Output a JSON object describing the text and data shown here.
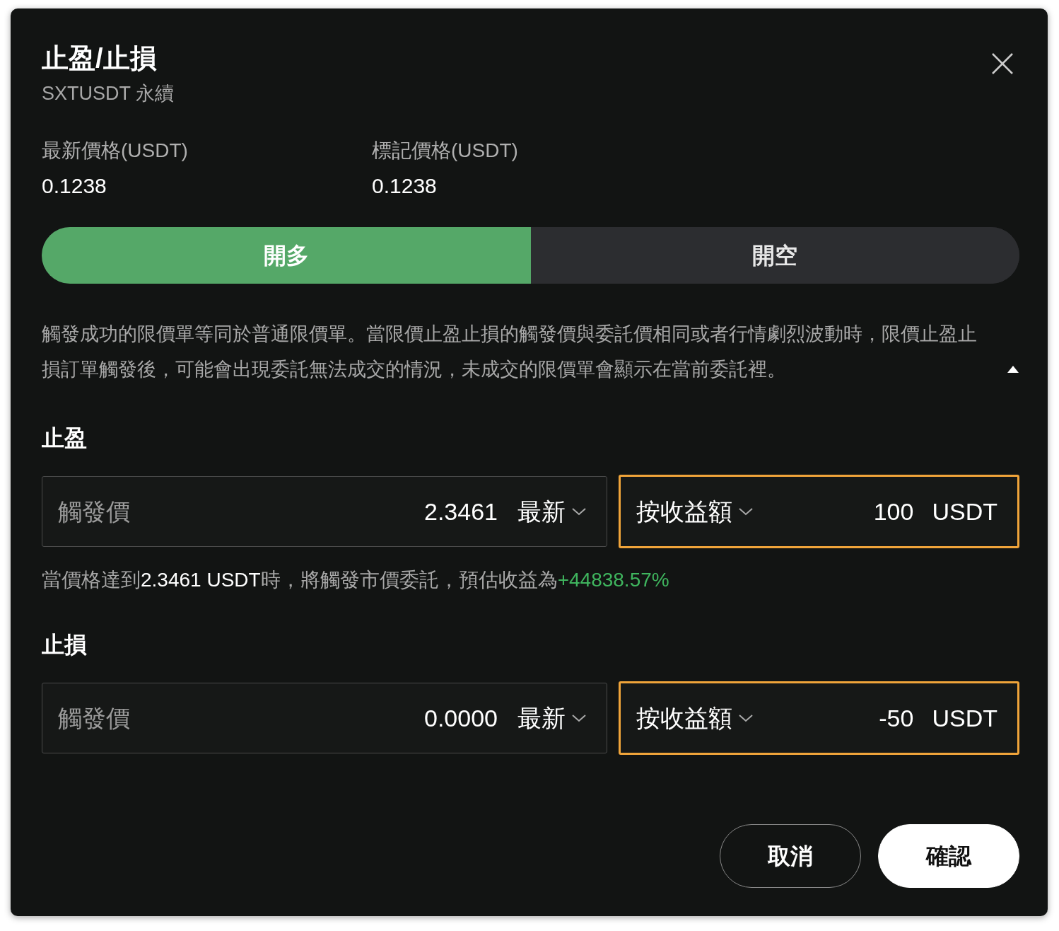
{
  "dialog": {
    "title": "止盈/止損",
    "subtitle": "SXTUSDT 永續"
  },
  "prices": [
    {
      "label": "最新價格(USDT)",
      "value": "0.1238"
    },
    {
      "label": "標記價格(USDT)",
      "value": "0.1238"
    }
  ],
  "tabs": [
    {
      "label": "開多",
      "selected": true
    },
    {
      "label": "開空",
      "selected": false
    }
  ],
  "notice": {
    "text": "觸發成功的限價單等同於普通限價單。當限價止盈止損的觸發價與委託價相同或者行情劇烈波動時，限價止盈止損訂單觸發後，可能會出現委託無法成交的情況，未成交的限價單會顯示在當前委託裡。",
    "expanded": true
  },
  "sections": [
    {
      "heading": "止盈",
      "trigger": {
        "placeholder": "觸發價",
        "value": "2.3461",
        "price_type": "最新"
      },
      "amount": {
        "mode": "按收益額",
        "value": "100",
        "unit": "USDT",
        "highlighted": true
      },
      "hint": {
        "text": "當價格達到**2.3461 USDT**時，將觸發市價委託，預估收益為",
        "profit": "+44838.57%"
      }
    },
    {
      "heading": "止損",
      "trigger": {
        "placeholder": "觸發價",
        "value": "0.0000",
        "price_type": "最新"
      },
      "amount": {
        "mode": "按收益額",
        "value": "-50",
        "unit": "USDT",
        "highlighted": true
      }
    }
  ],
  "buttons": [
    {
      "label": "取消",
      "kind": "secondary"
    },
    {
      "label": "確認",
      "kind": "primary"
    }
  ]
}
